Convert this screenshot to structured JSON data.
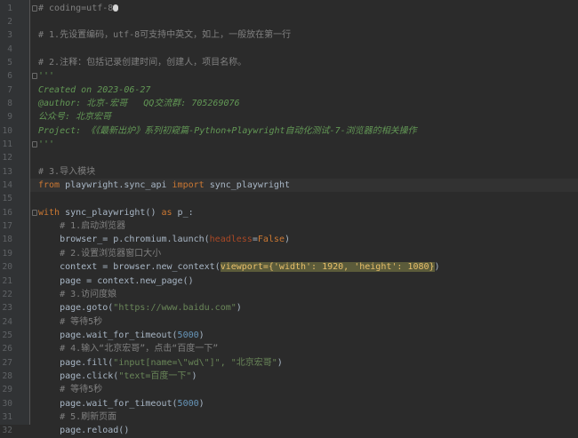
{
  "editor": {
    "lines": [
      {
        "n": "1",
        "parts": [
          [
            "comment",
            "# coding=utf-8"
          ]
        ],
        "fold": true,
        "caret": true
      },
      {
        "n": "2",
        "parts": []
      },
      {
        "n": "3",
        "parts": [
          [
            "comment",
            "# 1.先设置编码，utf-8可支持中英文，如上，一般放在第一行"
          ]
        ]
      },
      {
        "n": "4",
        "parts": []
      },
      {
        "n": "5",
        "parts": [
          [
            "comment",
            "# 2.注释：包括记录创建时间，创建人，项目名称。"
          ]
        ]
      },
      {
        "n": "6",
        "parts": [
          [
            "doc",
            "'''"
          ]
        ],
        "fold": true
      },
      {
        "n": "7",
        "parts": [
          [
            "doc",
            "Created on 2023-06-27"
          ]
        ]
      },
      {
        "n": "8",
        "parts": [
          [
            "doc",
            "@author: 北京-宏哥   QQ交流群: 705269076"
          ]
        ]
      },
      {
        "n": "9",
        "parts": [
          [
            "doc",
            "公众号: 北京宏哥"
          ]
        ]
      },
      {
        "n": "10",
        "parts": [
          [
            "doc",
            "Project: 《《最新出炉》系列初窥篇-Python+Playwright自动化测试-7-浏览器的相关操作"
          ]
        ]
      },
      {
        "n": "11",
        "parts": [
          [
            "doc",
            "'''"
          ]
        ],
        "fold": true
      },
      {
        "n": "12",
        "parts": []
      },
      {
        "n": "13",
        "parts": [
          [
            "comment",
            "# 3.导入模块"
          ]
        ]
      },
      {
        "n": "14",
        "parts": [
          [
            "kw",
            "from "
          ],
          [
            "ident",
            "playwright.sync_api "
          ],
          [
            "kw",
            "import "
          ],
          [
            "ident",
            "sync_playwright"
          ]
        ],
        "current": true
      },
      {
        "n": "15",
        "parts": []
      },
      {
        "n": "16",
        "parts": [
          [
            "kw",
            "with "
          ],
          [
            "ident",
            "sync_playwright() "
          ],
          [
            "kw",
            "as "
          ],
          [
            "ident",
            "p_:"
          ]
        ],
        "fold": true
      },
      {
        "n": "17",
        "parts": [
          [
            "ident",
            "    "
          ],
          [
            "comment",
            "# 1.启动浏览器"
          ]
        ]
      },
      {
        "n": "18",
        "parts": [
          [
            "ident",
            "    browser_= p.chromium.launch("
          ],
          [
            "param",
            "headless"
          ],
          [
            "ident",
            "="
          ],
          [
            "kw",
            "False"
          ],
          [
            "ident",
            ")"
          ]
        ]
      },
      {
        "n": "19",
        "parts": [
          [
            "ident",
            "    "
          ],
          [
            "comment",
            "# 2.设置浏览器窗口大小"
          ]
        ]
      },
      {
        "n": "20",
        "parts": [
          [
            "ident",
            "    context = browser.new_context("
          ],
          [
            "hl",
            "viewport={'width': 1920, 'height': 1080}"
          ],
          [
            "ident",
            ")"
          ]
        ]
      },
      {
        "n": "21",
        "parts": [
          [
            "ident",
            "    page = context.new_page()"
          ]
        ]
      },
      {
        "n": "22",
        "parts": [
          [
            "ident",
            "    "
          ],
          [
            "comment",
            "# 3.访问度娘"
          ]
        ]
      },
      {
        "n": "23",
        "parts": [
          [
            "ident",
            "    page.goto("
          ],
          [
            "str",
            "\"https://www.baidu.com\""
          ],
          [
            "ident",
            ")"
          ]
        ]
      },
      {
        "n": "24",
        "parts": [
          [
            "ident",
            "    "
          ],
          [
            "comment",
            "# 等待5秒"
          ]
        ]
      },
      {
        "n": "25",
        "parts": [
          [
            "ident",
            "    page.wait_for_timeout("
          ],
          [
            "num",
            "5000"
          ],
          [
            "ident",
            ")"
          ]
        ]
      },
      {
        "n": "26",
        "parts": [
          [
            "ident",
            "    "
          ],
          [
            "comment",
            "# 4.输入“北京宏哥”，点击“百度一下”"
          ]
        ]
      },
      {
        "n": "27",
        "parts": [
          [
            "ident",
            "    page.fill("
          ],
          [
            "str",
            "\"input[name=\\\"wd\\\"]\", \"北京宏哥\""
          ],
          [
            "ident",
            ")"
          ]
        ]
      },
      {
        "n": "28",
        "parts": [
          [
            "ident",
            "    page.click("
          ],
          [
            "str",
            "\"text=百度一下\""
          ],
          [
            "ident",
            ")"
          ]
        ]
      },
      {
        "n": "29",
        "parts": [
          [
            "ident",
            "    "
          ],
          [
            "comment",
            "# 等待5秒"
          ]
        ]
      },
      {
        "n": "30",
        "parts": [
          [
            "ident",
            "    page.wait_for_timeout("
          ],
          [
            "num",
            "5000"
          ],
          [
            "ident",
            ")"
          ]
        ]
      },
      {
        "n": "31",
        "parts": [
          [
            "ident",
            "    "
          ],
          [
            "comment",
            "# 5.刷新页面"
          ]
        ]
      },
      {
        "n": "32",
        "parts": [
          [
            "ident",
            "    page.reload()"
          ]
        ]
      }
    ]
  }
}
